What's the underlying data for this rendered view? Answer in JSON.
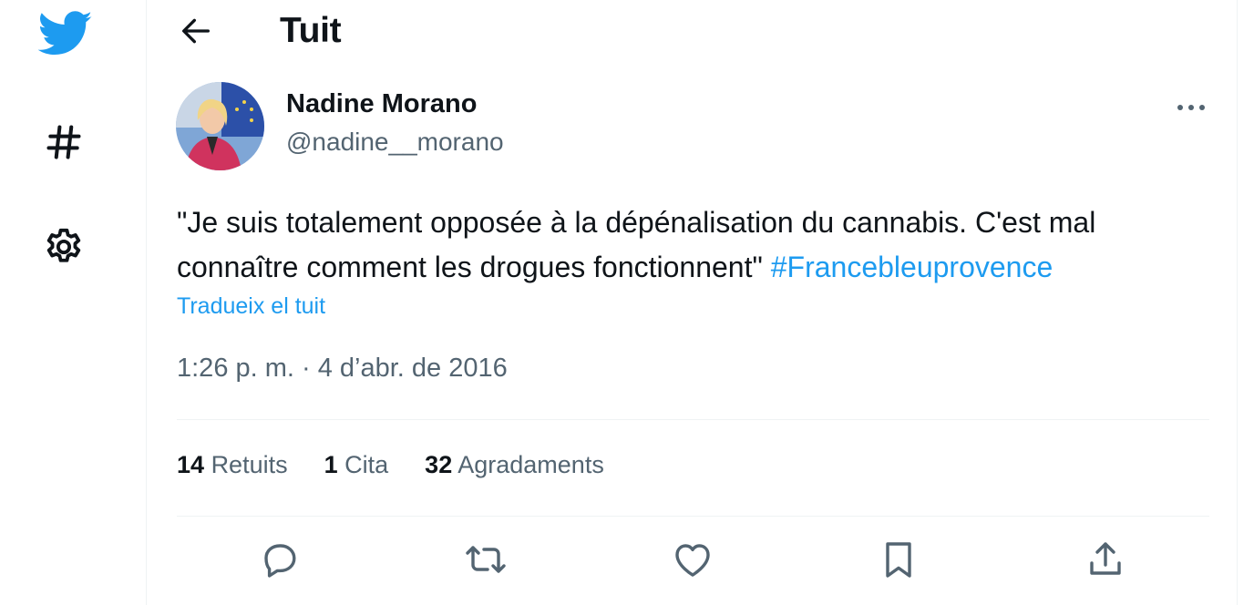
{
  "sidebar": {
    "icons": [
      "twitter-bird-icon",
      "hashtag-icon",
      "gear-icon"
    ]
  },
  "header": {
    "title": "Tuit",
    "back_icon": "arrow-left-icon"
  },
  "tweet": {
    "display_name": "Nadine Morano",
    "handle": "@nadine__morano",
    "text": "\"Je suis totalement opposée à la dépénalisation du cannabis. C'est mal connaître comment les drogues fonctionnent\" ",
    "hashtag": "#Francebleuprovence",
    "translate_label": "Tradueix el tuit",
    "timestamp": "1:26 p. m. · 4 d’abr. de 2016"
  },
  "stats": [
    {
      "count": "14",
      "label": "Retuits"
    },
    {
      "count": "1",
      "label": "Cita"
    },
    {
      "count": "32",
      "label": "Agradaments"
    }
  ],
  "actions": [
    "reply-icon",
    "retweet-icon",
    "like-icon",
    "bookmark-icon",
    "share-icon"
  ],
  "colors": {
    "accent": "#1d9bf0",
    "text_primary": "#0f1419",
    "text_secondary": "#536471",
    "divider": "#eff3f4"
  }
}
